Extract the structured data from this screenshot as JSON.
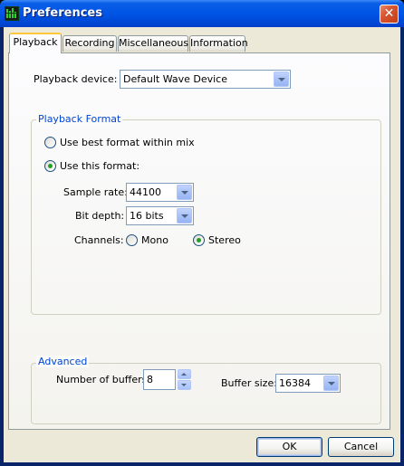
{
  "window": {
    "title": "Preferences",
    "close_symbol": "✕"
  },
  "tabs": [
    {
      "label": "Playback",
      "active": true
    },
    {
      "label": "Recording",
      "active": false
    },
    {
      "label": "Miscellaneous",
      "active": false
    },
    {
      "label": "Information",
      "active": false
    }
  ],
  "playback": {
    "device_label": "Playback device:",
    "device_value": "Default Wave Device",
    "format_group": {
      "title": "Playback Format",
      "option_best": "Use best format within mix",
      "option_this": "Use this format:",
      "selected": "this",
      "sample_rate_label": "Sample rate:",
      "sample_rate_value": "44100",
      "bit_depth_label": "Bit depth:",
      "bit_depth_value": "16 bits",
      "channels_label": "Channels:",
      "channel_mono": "Mono",
      "channel_stereo": "Stereo",
      "channel_selected": "stereo"
    },
    "advanced_group": {
      "title": "Advanced",
      "buffers_label": "Number of buffers:",
      "buffers_value": "8",
      "buffer_size_label": "Buffer size:",
      "buffer_size_value": "16384"
    }
  },
  "buttons": {
    "ok": "OK",
    "cancel": "Cancel"
  }
}
